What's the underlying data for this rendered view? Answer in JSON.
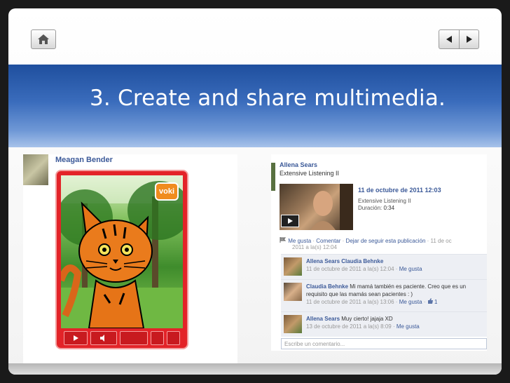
{
  "slide": {
    "title": "3. Create and share multimedia."
  },
  "nav": {
    "home_icon": "home-icon",
    "prev_icon": "triangle-left-icon",
    "next_icon": "triangle-right-icon"
  },
  "voki_post": {
    "author": "Meagan Bender",
    "logo_text": "voki"
  },
  "fb_post": {
    "author": "Allena Sears",
    "subtitle": "Extensive Listening II",
    "video": {
      "date": "11 de octubre de 2011 12:03",
      "title": "Extensive Listening II",
      "duration_label": "Duración:",
      "duration_value": "0:34"
    },
    "actions": {
      "like": "Me gusta",
      "comment": "Comentar",
      "unfollow": "Dejar de seguir esta publicación",
      "sep": "·",
      "timestamp_start": "11 de oc",
      "timestamp_rest": "2011 a la(s) 12:04"
    },
    "comments": [
      {
        "author": "Allena Sears",
        "text": "Claudia Behnke",
        "meta": "11 de octubre de 2011 a la(s) 12:04",
        "like": "Me gusta"
      },
      {
        "author": "Claudia Behnke",
        "text": "Mi mamá también es paciente. Creo que es un requisito que las mamás sean pacientes : )",
        "meta": "11 de octubre de 2011 a la(s) 13:06",
        "like": "Me gusta",
        "likes_count": "1"
      },
      {
        "author": "Allena Sears",
        "text": "Muy cierto! jajaja XD",
        "meta": "13 de octubre de 2011 a la(s) 8:09",
        "like": "Me gusta"
      }
    ],
    "write_placeholder": "Escribe un comentario..."
  },
  "colors": {
    "fb_link": "#3b5998",
    "title_band": "#2f5fae",
    "voki_red": "#e32328"
  }
}
